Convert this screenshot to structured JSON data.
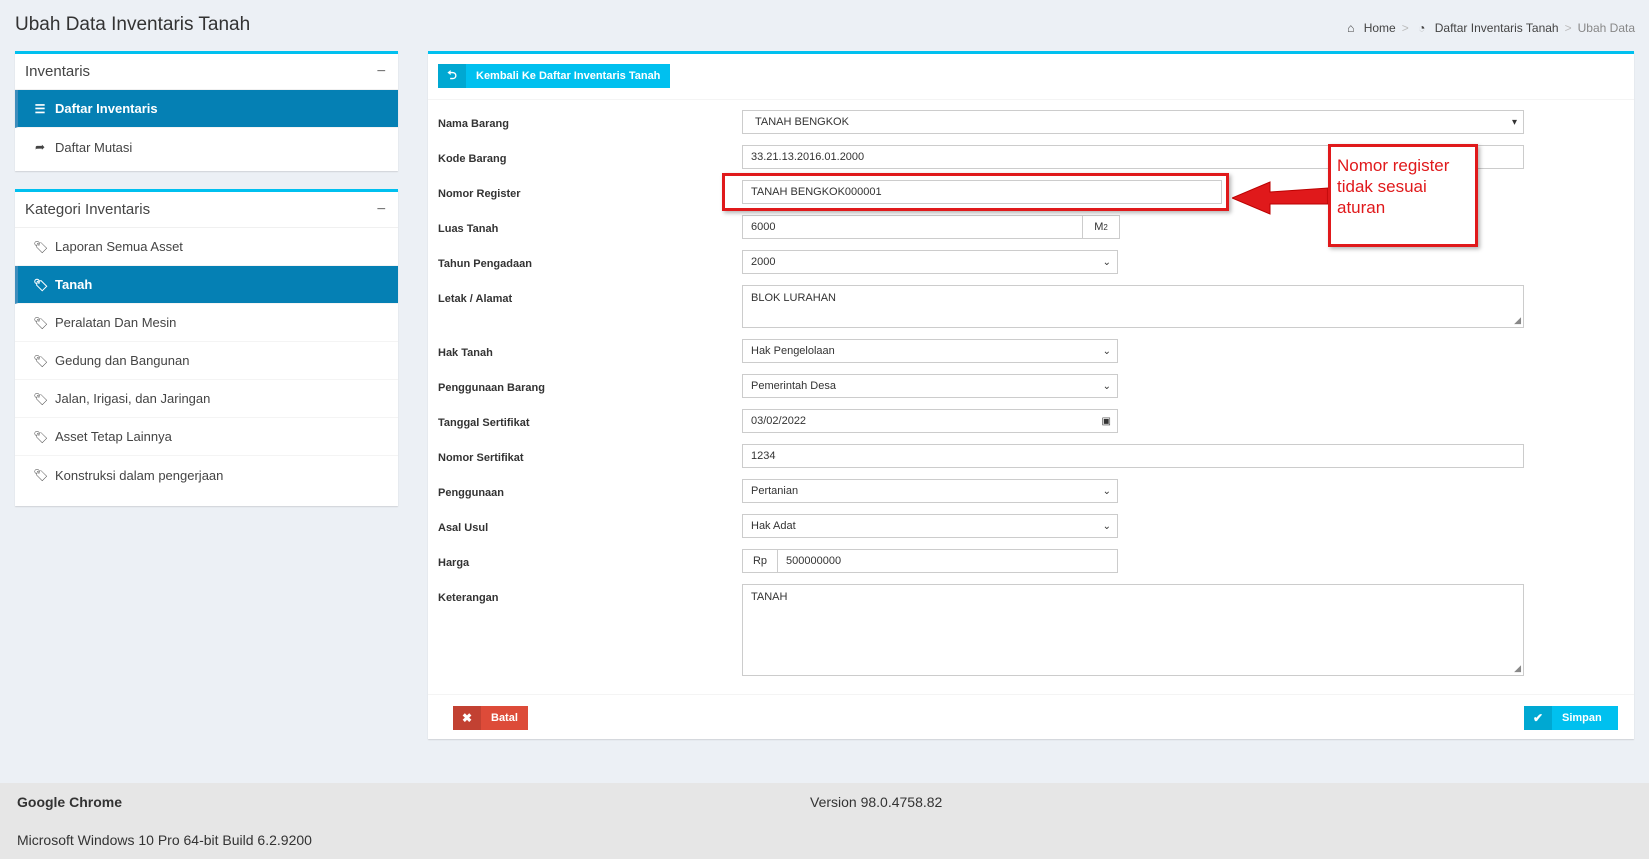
{
  "page": {
    "title": "Ubah Data Inventaris Tanah"
  },
  "breadcrumb": {
    "home": "Home",
    "list": "Daftar Inventaris Tanah",
    "current": "Ubah Data",
    "sep": ">"
  },
  "sidebar1": {
    "title": "Inventaris",
    "items": [
      {
        "label": "Daftar Inventaris",
        "icon": "list-icon"
      },
      {
        "label": "Daftar Mutasi",
        "icon": "share-icon"
      }
    ]
  },
  "sidebar2": {
    "title": "Kategori Inventaris",
    "items": [
      {
        "label": "Laporan Semua Asset"
      },
      {
        "label": "Tanah"
      },
      {
        "label": "Peralatan Dan Mesin"
      },
      {
        "label": "Gedung dan Bangunan"
      },
      {
        "label": "Jalan, Irigasi, dan Jaringan"
      },
      {
        "label": "Asset Tetap Lainnya"
      },
      {
        "label": "Konstruksi dalam pengerjaan"
      }
    ]
  },
  "main": {
    "back_label": "Kembali Ke Daftar Inventaris Tanah",
    "labels": {
      "nama_barang": "Nama Barang",
      "kode_barang": "Kode Barang",
      "nomor_register": "Nomor Register",
      "luas_tanah": "Luas Tanah",
      "tahun_pengadaan": "Tahun Pengadaan",
      "letak": "Letak / Alamat",
      "hak_tanah": "Hak Tanah",
      "penggunaan_barang": "Penggunaan Barang",
      "tanggal_sertifikat": "Tanggal Sertifikat",
      "nomor_sertifikat": "Nomor Sertifikat",
      "penggunaan": "Penggunaan",
      "asal_usul": "Asal Usul",
      "harga": "Harga",
      "keterangan": "Keterangan"
    },
    "values": {
      "nama_barang": "TANAH BENGKOK",
      "kode_barang": "33.21.13.2016.01.2000",
      "nomor_register": "TANAH BENGKOK000001",
      "luas_tanah": "6000",
      "luas_unit": "M",
      "luas_unit_sup": "2",
      "tahun_pengadaan": "2000",
      "letak": "BLOK LURAHAN",
      "hak_tanah": "Hak Pengelolaan",
      "penggunaan_barang": "Pemerintah Desa",
      "tanggal_sertifikat": "03/02/2022",
      "nomor_sertifikat": "1234",
      "penggunaan": "Pertanian",
      "asal_usul": "Hak Adat",
      "harga_prefix": "Rp",
      "harga": "500000000",
      "keterangan": "TANAH"
    },
    "cancel_label": "Batal",
    "save_label": "Simpan"
  },
  "annotation": {
    "line1": "Nomor register",
    "line2": "tidak sesuai",
    "line3": "aturan",
    "color": "#e0191b"
  },
  "footer": {
    "app": "Google Chrome",
    "version": "Version 98.0.4758.82",
    "os": "Microsoft Windows 10 Pro 64-bit Build 6.2.9200"
  },
  "colors": {
    "accent": "#00c0ef",
    "active": "#0580b4",
    "danger": "#dd4b39",
    "background": "#ecf0f5"
  }
}
